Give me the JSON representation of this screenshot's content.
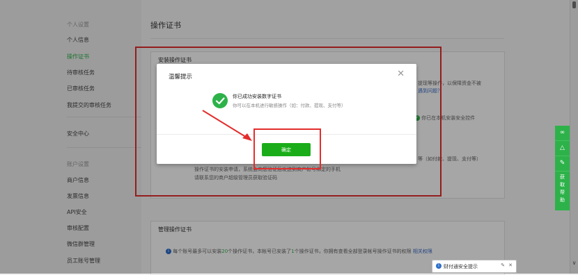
{
  "sidebar": {
    "group1": "个人设置",
    "items1": [
      "个人信息",
      "操作证书",
      "待审核任务",
      "已审核任务",
      "我提交的审核任务"
    ],
    "security": "安全中心",
    "group2": "账户设置",
    "items2": [
      "商户信息",
      "发票信息",
      "API安全",
      "审核配置",
      "微信群管理",
      "员工账号管理"
    ]
  },
  "main": {
    "title": "操作证书",
    "install_section": {
      "header": "安装操作证书",
      "text1": "提现等操作，以保障资金不被",
      "link1": "遇到问题？",
      "installed_status": "你已在本机安装安全控件",
      "ops_text": "等（如付款、提现、支付等）",
      "desc1": "操作证书的安装申请，系统会向您验证后发送到商户帐号绑定的手机",
      "desc2": "请联系您的商户超级管理员获取验证码"
    },
    "manage_section": {
      "header": "管理操作证书",
      "info_prefix": "每个账号最多可以安装",
      "info_count1": "20",
      "info_mid1": "个操作证书，本帐号已安装了",
      "info_count2": "1",
      "info_mid2": "个操作证书，你拥有查看全部登录帐号操作证书的权限",
      "info_link": "相关权限"
    }
  },
  "modal": {
    "title": "温馨提示",
    "close_icon": "close-icon",
    "message": "你已成功安装数字证书",
    "submessage": "你可以在本机进行敏感操作（如：付款、提现、支付等）",
    "confirm_label": "确定"
  },
  "side_tools": {
    "help_label": [
      "获",
      "取",
      "帮",
      "助"
    ]
  },
  "popup": {
    "label": "财付通安全提示",
    "settings_glyph": "✎",
    "close_glyph": "✕"
  },
  "colors": {
    "accent_green": "#1aad19",
    "annotation_red": "#e42c2c",
    "link_blue": "#3a6bc4"
  }
}
